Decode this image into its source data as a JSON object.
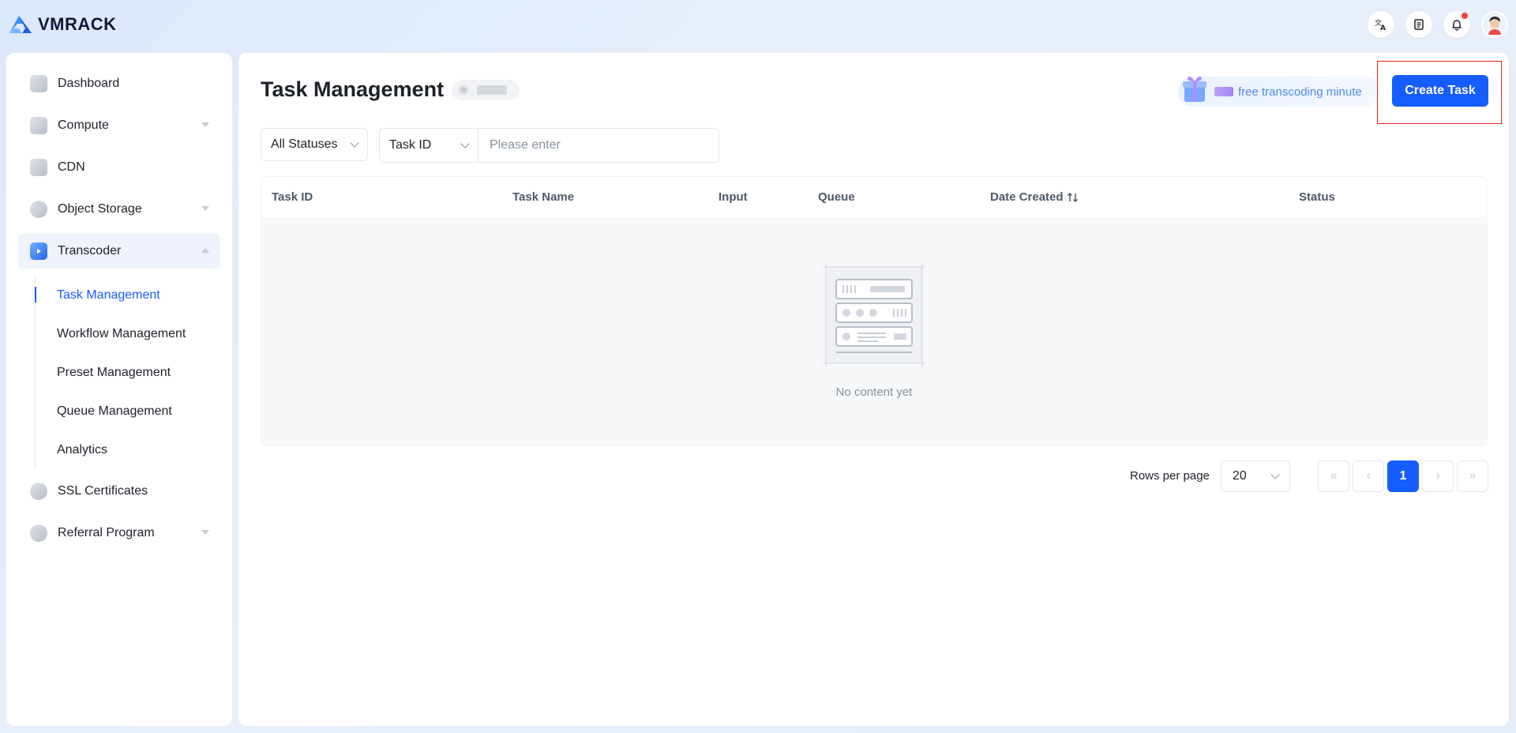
{
  "brand": {
    "name": "VMRACK"
  },
  "topbar": {
    "icons": [
      "translate-icon",
      "document-icon",
      "bell-icon"
    ],
    "has_notification": true
  },
  "sidebar": {
    "items": [
      {
        "label": "Dashboard",
        "icon": "dashboard-icon",
        "expandable": false
      },
      {
        "label": "Compute",
        "icon": "compute-icon",
        "expandable": true
      },
      {
        "label": "CDN",
        "icon": "cdn-icon",
        "expandable": false
      },
      {
        "label": "Object Storage",
        "icon": "storage-icon",
        "expandable": true
      },
      {
        "label": "Transcoder",
        "icon": "transcoder-icon",
        "expandable": true,
        "expanded": true
      },
      {
        "label": "SSL Certificates",
        "icon": "shield-icon",
        "expandable": false
      },
      {
        "label": "Referral Program",
        "icon": "referral-icon",
        "expandable": true
      }
    ],
    "transcoder_sub": [
      {
        "label": "Task Management",
        "active": true
      },
      {
        "label": "Workflow Management"
      },
      {
        "label": "Preset Management"
      },
      {
        "label": "Queue Management"
      },
      {
        "label": "Analytics"
      }
    ]
  },
  "page": {
    "title": "Task Management",
    "promo_text": "free transcoding minute",
    "create_button": "Create Task"
  },
  "filters": {
    "status_select": "All Statuses",
    "field_select": "Task ID",
    "search_placeholder": "Please enter"
  },
  "table": {
    "columns": [
      "Task ID",
      "Task Name",
      "Input",
      "Queue",
      "Date Created",
      "Status"
    ],
    "rows": [],
    "empty_text": "No content yet"
  },
  "pagination": {
    "rows_label": "Rows per page",
    "rows_per_page": "20",
    "current_page": "1"
  },
  "colors": {
    "accent": "#165dff",
    "highlight_box": "#e02020"
  }
}
